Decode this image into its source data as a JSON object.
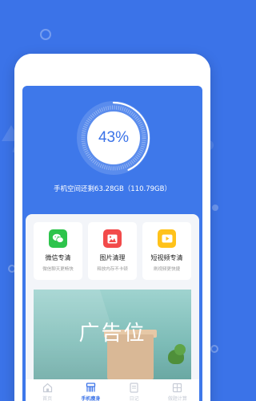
{
  "gauge": {
    "percent_label": "43%",
    "fraction": 0.43
  },
  "storage": {
    "text": "手机空间还剩63.28GB（110.79GB）"
  },
  "tiles": [
    {
      "title": "微信专清",
      "subtitle": "微信聊天更畅快",
      "icon": "wechat-icon",
      "color": "#2dc44b"
    },
    {
      "title": "图片清理",
      "subtitle": "释放内存不卡顿",
      "icon": "image-icon",
      "color": "#f24a4a"
    },
    {
      "title": "短视频专清",
      "subtitle": "刷视频更快捷",
      "icon": "video-icon",
      "color": "#ffc21a"
    }
  ],
  "ad": {
    "text": "广告位"
  },
  "tabs": [
    {
      "label": "首页",
      "icon": "home-icon",
      "active": false
    },
    {
      "label": "手机瘦身",
      "icon": "broom-icon",
      "active": true
    },
    {
      "label": "日记",
      "icon": "notebook-icon",
      "active": false
    },
    {
      "label": "做题计算",
      "icon": "calculator-icon",
      "active": false
    }
  ],
  "colors": {
    "brand": "#3b73e8",
    "inactive_tab": "#c7ccd6"
  }
}
